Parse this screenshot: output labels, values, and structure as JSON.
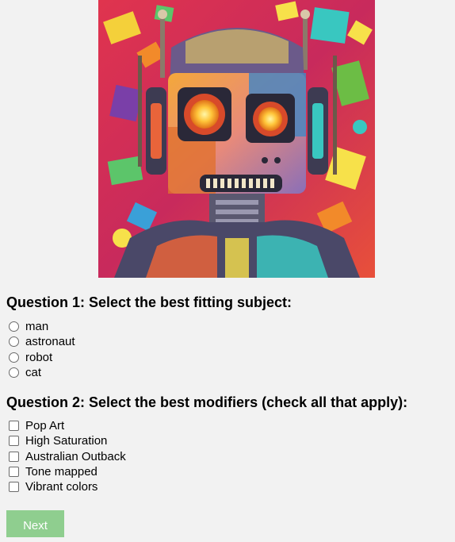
{
  "image": {
    "subject_icon": "robot-pop-art-image"
  },
  "question1": {
    "title": "Question 1: Select the best fitting subject:",
    "options": [
      "man",
      "astronaut",
      "robot",
      "cat"
    ]
  },
  "question2": {
    "title": "Question 2: Select the best modifiers (check all that apply):",
    "options": [
      "Pop Art",
      "High Saturation",
      "Australian Outback",
      "Tone mapped",
      "Vibrant colors"
    ]
  },
  "next_button": {
    "label": "Next",
    "color": "#8fce8f"
  },
  "colors": {
    "background": "#f2f2f2",
    "button_text": "#ffffff"
  }
}
